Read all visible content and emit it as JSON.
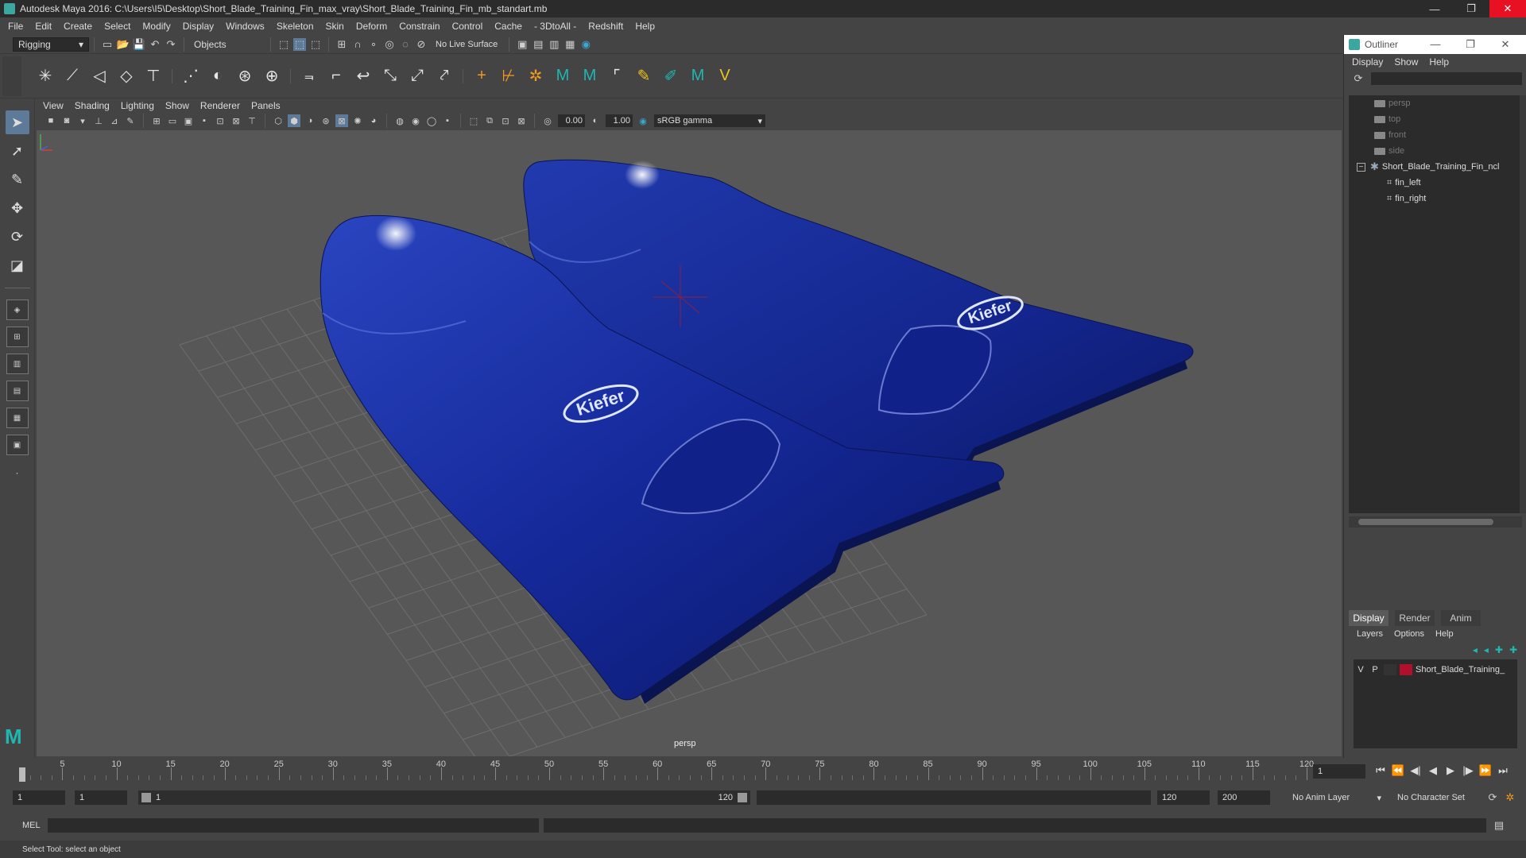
{
  "window": {
    "title": "Autodesk Maya 2016: C:\\Users\\I5\\Desktop\\Short_Blade_Training_Fin_max_vray\\Short_Blade_Training_Fin_mb_standart.mb",
    "buttons": [
      "—",
      "❐",
      "✕"
    ]
  },
  "menu": [
    "File",
    "Edit",
    "Create",
    "Select",
    "Modify",
    "Display",
    "Windows",
    "Skeleton",
    "Skin",
    "Deform",
    "Constrain",
    "Control",
    "Cache",
    "- 3DtoAll -",
    "Redshift",
    "Help"
  ],
  "status_line": {
    "mode": "Rigging",
    "selection_mask": "Objects",
    "live_surface": "No Live Surface"
  },
  "panel": {
    "menu": [
      "View",
      "Shading",
      "Lighting",
      "Show",
      "Renderer",
      "Panels"
    ],
    "exposure": "0.00",
    "gamma_value": "1.00",
    "color_space": "sRGB gamma",
    "camera_label": "persp"
  },
  "viewport": {
    "logo_text": "Kiefer",
    "fin_color": "#14289a",
    "background_color": "#575757"
  },
  "outliner": {
    "title": "Outliner",
    "menu": [
      "Display",
      "Show",
      "Help"
    ],
    "items": [
      {
        "label": "persp",
        "type": "camera"
      },
      {
        "label": "top",
        "type": "camera"
      },
      {
        "label": "front",
        "type": "camera"
      },
      {
        "label": "side",
        "type": "camera"
      },
      {
        "label": "Short_Blade_Training_Fin_ncl",
        "type": "group"
      },
      {
        "label": "fin_left",
        "type": "mesh"
      },
      {
        "label": "fin_right",
        "type": "mesh"
      }
    ]
  },
  "layer_editor": {
    "tabs": [
      "Display",
      "Render",
      "Anim"
    ],
    "menu": [
      "Layers",
      "Options",
      "Help"
    ],
    "layer": {
      "v": "V",
      "p": "P",
      "name": "Short_Blade_Training_",
      "color": "#b0102c"
    }
  },
  "time_slider": {
    "labels": [
      "1",
      "5",
      "10",
      "15",
      "20",
      "25",
      "30",
      "35",
      "40",
      "45",
      "50",
      "55",
      "60",
      "65",
      "70",
      "75",
      "80",
      "85",
      "90",
      "95",
      "100",
      "105",
      "110",
      "115",
      "120"
    ],
    "current_frame": "1"
  },
  "range_slider": {
    "start": "1",
    "playback_start": "1",
    "range_start_label": "1",
    "range_end_label": "120",
    "playback_end": "120",
    "end": "200",
    "anim_layer": "No Anim Layer",
    "character_set": "No Character Set"
  },
  "command_line": {
    "label": "MEL"
  },
  "help_line": "Select Tool: select an object"
}
